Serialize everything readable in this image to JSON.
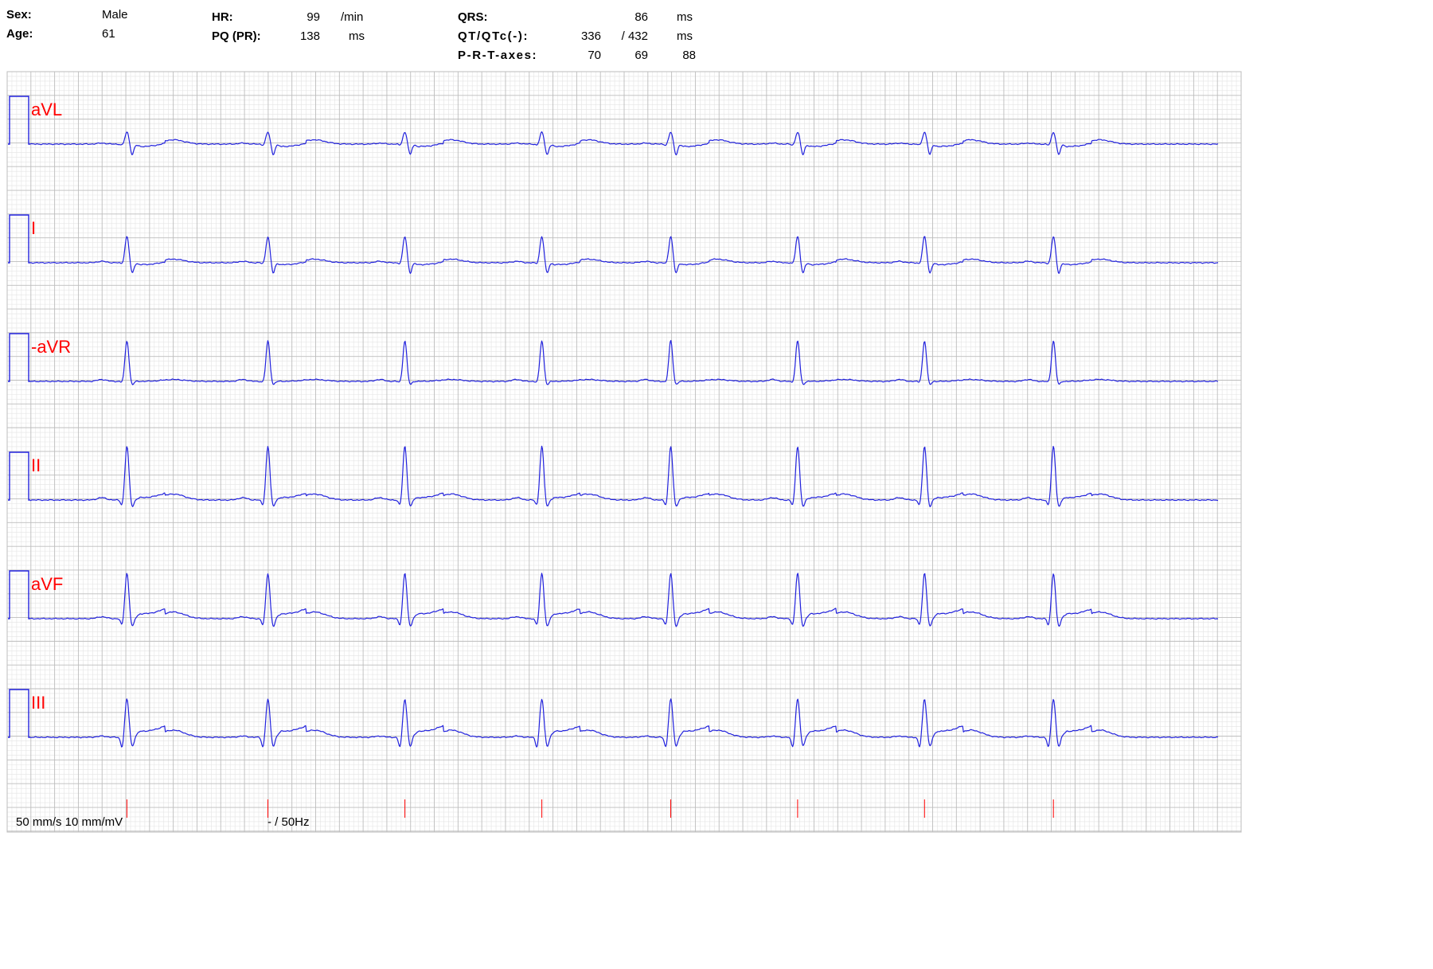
{
  "header": {
    "sex_label": "Sex:",
    "sex_value": "Male",
    "age_label": "Age:",
    "age_value": "61",
    "hr_label": "HR:",
    "hr_value": "99",
    "hr_unit": "/min",
    "pq_label": "PQ (PR):",
    "pq_value": "138",
    "pq_unit": "ms",
    "qrs_label": "QRS:",
    "qrs_value": "86",
    "qrs_unit": "ms",
    "qt_label": "QT/QTc(-):",
    "qt_value": "336",
    "qtc_value": "/ 432",
    "qt_unit": "ms",
    "axes_label": "P-R-T-axes:",
    "p_axis": "70",
    "r_axis": "69",
    "t_axis": "88"
  },
  "footer": {
    "speed_gain": "50 mm/s 10 mm/mV",
    "filter": "- / 50Hz"
  },
  "colors": {
    "grid_minor": "#e4e4e4",
    "grid_major": "#bdbdbd",
    "trace": "#2222dd",
    "label": "#ff0000",
    "beat_marker": "#ff0000"
  },
  "chart_data": {
    "type": "line",
    "title": "",
    "xlabel": "",
    "ylabel": "",
    "paper_speed_mm_per_s": 50,
    "gain_mm_per_mV": 10,
    "calibration_mV": 1.0,
    "xlim_s": [
      0,
      6.0
    ],
    "grid": true,
    "beat_times_s": [
      0.48,
      1.18,
      1.86,
      2.54,
      3.18,
      3.81,
      4.44,
      5.08
    ],
    "leads": [
      {
        "name": "aVL",
        "p": 0.04,
        "q": -0.05,
        "r": 0.5,
        "s": -0.45,
        "t": 0.18,
        "st": -0.1
      },
      {
        "name": "I",
        "p": 0.06,
        "q": -0.05,
        "r": 1.1,
        "s": -0.45,
        "t": 0.15,
        "st": -0.08
      },
      {
        "name": "-aVR",
        "p": 0.08,
        "q": -0.05,
        "r": 1.7,
        "s": -0.15,
        "t": 0.08,
        "st": 0.0
      },
      {
        "name": "II",
        "p": 0.1,
        "q": -0.25,
        "r": 2.25,
        "s": -0.3,
        "t": 0.25,
        "st": 0.1
      },
      {
        "name": "aVF",
        "p": 0.08,
        "q": -0.3,
        "r": 1.9,
        "s": -0.35,
        "t": 0.28,
        "st": 0.2
      },
      {
        "name": "III",
        "p": 0.05,
        "q": -0.45,
        "r": 1.6,
        "s": -0.4,
        "t": 0.3,
        "st": 0.25
      }
    ]
  }
}
